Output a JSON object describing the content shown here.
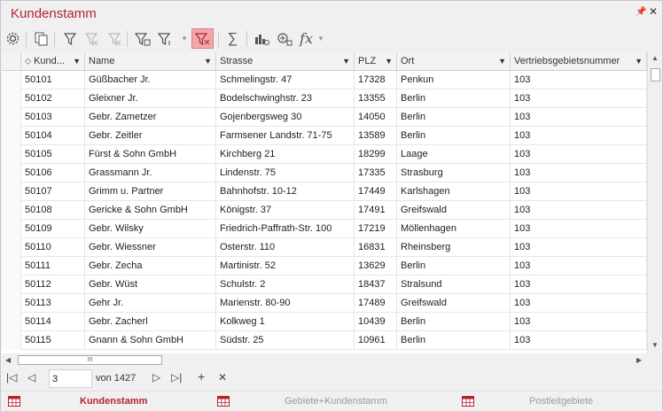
{
  "window": {
    "title": "Kundenstamm",
    "pin_glyph": "⫫",
    "close_glyph": "✕"
  },
  "toolbar": {
    "icons": [
      "gear-icon",
      "copy-icon",
      "filter-icon",
      "clear-filter-icon",
      "clear-all-filters-icon",
      "filter-table-icon",
      "filter-row-icon",
      "active-filter-icon",
      "sum-icon",
      "chart-icon",
      "add-field-icon",
      "function-icon"
    ],
    "sum_glyph": "∑",
    "fx_glyph": "fx"
  },
  "grid": {
    "columns": [
      {
        "key": "kund",
        "label": "Kund..."
      },
      {
        "key": "name",
        "label": "Name"
      },
      {
        "key": "strasse",
        "label": "Strasse"
      },
      {
        "key": "plz",
        "label": "PLZ"
      },
      {
        "key": "ort",
        "label": "Ort"
      },
      {
        "key": "vgn",
        "label": "Vertriebsgebietsnummer"
      }
    ],
    "rows": [
      [
        "50101",
        "Güßbacher Jr.",
        "Schmelingstr. 47",
        "17328",
        "Penkun",
        "103"
      ],
      [
        "50102",
        "Gleixner Jr.",
        "Bodelschwinghstr. 23",
        "13355",
        "Berlin",
        "103"
      ],
      [
        "50103",
        "Gebr. Zametzer",
        "Gojenbergsweg 30",
        "14050",
        "Berlin",
        "103"
      ],
      [
        "50104",
        "Gebr. Zeitler",
        "Farmsener Landstr. 71-75",
        "13589",
        "Berlin",
        "103"
      ],
      [
        "50105",
        "Fürst & Sohn GmbH",
        "Kirchberg 21",
        "18299",
        "Laage",
        "103"
      ],
      [
        "50106",
        "Grassmann Jr.",
        "Lindenstr. 75",
        "17335",
        "Strasburg",
        "103"
      ],
      [
        "50107",
        "Grimm u. Partner",
        "Bahnhofstr. 10-12",
        "17449",
        "Karlshagen",
        "103"
      ],
      [
        "50108",
        "Gericke & Sohn GmbH",
        "Königstr. 37",
        "17491",
        "Greifswald",
        "103"
      ],
      [
        "50109",
        "Gebr. Wilsky",
        "Friedrich-Paffrath-Str. 100",
        "17219",
        "Möllenhagen",
        "103"
      ],
      [
        "50110",
        "Gebr. Wiessner",
        "Osterstr. 110",
        "16831",
        "Rheinsberg",
        "103"
      ],
      [
        "50111",
        "Gebr. Zecha",
        "Martinistr. 52",
        "13629",
        "Berlin",
        "103"
      ],
      [
        "50112",
        "Gebr. Wüst",
        "Schulstr. 2",
        "18437",
        "Stralsund",
        "103"
      ],
      [
        "50113",
        "Gehr Jr.",
        "Marienstr. 80-90",
        "17489",
        "Greifswald",
        "103"
      ],
      [
        "50114",
        "Gebr. Zacherl",
        "Kolkweg 1",
        "10439",
        "Berlin",
        "103"
      ],
      [
        "50115",
        "Gnann & Sohn GmbH",
        "Südstr. 25",
        "10961",
        "Berlin",
        "103"
      ]
    ]
  },
  "scroll": {
    "h_thumb_glyph": "III"
  },
  "navigator": {
    "page_value": "3",
    "of_label": "von 1427",
    "first_glyph": "|◁",
    "prev_glyph": "◁",
    "next_glyph": "▷",
    "last_glyph": "▷|",
    "add_glyph": "+",
    "delete_glyph": "✕"
  },
  "tabs": [
    {
      "label": "Kundenstamm",
      "active": true
    },
    {
      "label": "Gebiete+Kundenstamm",
      "active": false
    },
    {
      "label": "Postleitgebiete",
      "active": false
    }
  ],
  "colors": {
    "accent": "#b3232f",
    "active_button": "#f0a7ab",
    "toolbar_bg": "#f0f0f0"
  }
}
